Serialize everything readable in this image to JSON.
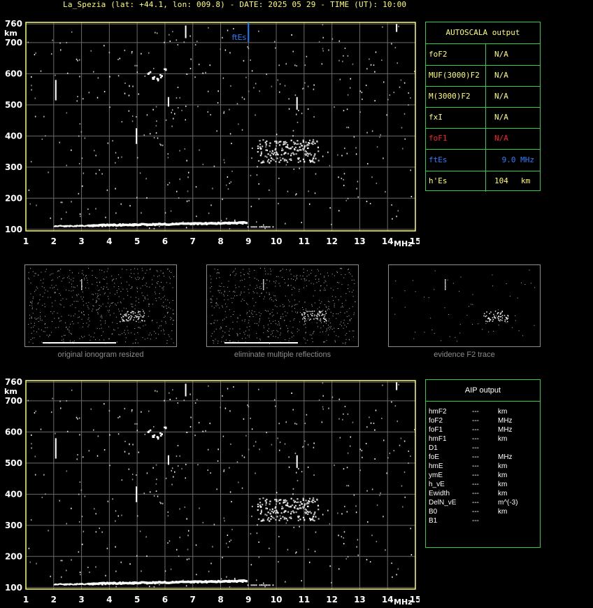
{
  "header": {
    "title": "La_Spezia (lat: +44.1, lon: 009.8) - DATE: 2025 05 29 - TIME (UT): 10:00"
  },
  "colors": {
    "axis": "#ffff66",
    "grid": "#6b6b6b",
    "table_border": "#2ecc40",
    "fte_blue": "#2a7fff",
    "fof1_red": "#ff2020",
    "text_yellow": "#ffff66"
  },
  "chart_data": [
    {
      "type": "scatter",
      "title": "",
      "xlabel": "MHz",
      "ylabel": "km",
      "xlim": [
        1,
        15
      ],
      "ylim": [
        95,
        765
      ],
      "x_ticks": [
        "1",
        "2",
        "3",
        "4",
        "5",
        "6",
        "7",
        "8",
        "9",
        "10",
        "11",
        "12",
        "13",
        "14",
        "15"
      ],
      "y_ticks": [
        "100",
        "200",
        "300",
        "400",
        "500",
        "600",
        "700",
        "760"
      ],
      "grid": true,
      "marker": {
        "label": "ftEs",
        "x": 9.0
      },
      "traces": [
        {
          "name": "",
          "points": [
            [
              2.0,
              107
            ],
            [
              2.5,
              110
            ],
            [
              3.0,
              112
            ],
            [
              3.5,
              114
            ],
            [
              4.0,
              115
            ],
            [
              5.0,
              115
            ],
            [
              6.0,
              116
            ],
            [
              7.0,
              117
            ],
            [
              8.0,
              118
            ],
            [
              8.8,
              118
            ]
          ]
        },
        {
          "name": "",
          "points": [
            [
              5.4,
              605
            ],
            [
              5.55,
              590
            ],
            [
              5.7,
              585
            ],
            [
              5.85,
              595
            ],
            [
              6.0,
              615
            ]
          ]
        },
        {
          "name": "",
          "points": [
            [
              9.5,
              360
            ],
            [
              10.0,
              355
            ],
            [
              10.5,
              350
            ],
            [
              11.0,
              345
            ],
            [
              11.4,
              340
            ]
          ]
        }
      ]
    },
    {
      "type": "scatter",
      "title": "",
      "xlabel": "MHz",
      "ylabel": "km",
      "xlim": [
        1,
        15
      ],
      "ylim": [
        95,
        765
      ],
      "x_ticks": [
        "1",
        "2",
        "3",
        "4",
        "5",
        "6",
        "7",
        "8",
        "9",
        "10",
        "11",
        "12",
        "13",
        "14",
        "15"
      ],
      "y_ticks": [
        "100",
        "200",
        "300",
        "400",
        "500",
        "600",
        "700",
        "760"
      ],
      "grid": true,
      "traces": [
        {
          "name": "",
          "points": [
            [
              2.0,
              107
            ],
            [
              2.5,
              110
            ],
            [
              3.0,
              112
            ],
            [
              3.5,
              114
            ],
            [
              4.0,
              115
            ],
            [
              5.0,
              115
            ],
            [
              6.0,
              116
            ],
            [
              7.0,
              117
            ],
            [
              8.0,
              118
            ],
            [
              8.8,
              118
            ]
          ]
        },
        {
          "name": "",
          "points": [
            [
              5.4,
              605
            ],
            [
              5.55,
              590
            ],
            [
              5.7,
              585
            ],
            [
              5.85,
              595
            ],
            [
              6.0,
              615
            ]
          ]
        },
        {
          "name": "",
          "points": [
            [
              9.5,
              360
            ],
            [
              10.0,
              355
            ],
            [
              10.5,
              350
            ],
            [
              11.0,
              345
            ],
            [
              11.4,
              340
            ]
          ]
        }
      ]
    }
  ],
  "autoscala": {
    "title": "AUTOSCALA output",
    "rows": [
      {
        "param": "foF2",
        "value": "N/A",
        "unit": "",
        "color": "#ffff66"
      },
      {
        "param": "MUF(3000)F2",
        "value": "N/A",
        "unit": "",
        "color": "#ffff66"
      },
      {
        "param": "M(3000)F2",
        "value": "N/A",
        "unit": "",
        "color": "#ffff66"
      },
      {
        "param": "fxI",
        "value": "N/A",
        "unit": "",
        "color": "#ffff66"
      },
      {
        "param": "foF1",
        "value": "N/A",
        "unit": "",
        "color": "#ff2020"
      },
      {
        "param": "ftEs",
        "value": "9.0 MHz",
        "unit": "",
        "color": "#2a7fff"
      },
      {
        "param": "h'Es",
        "value": "104",
        "unit": "km",
        "color": "#ffff66"
      }
    ]
  },
  "thumbnails": [
    {
      "caption": "original ionogram resized"
    },
    {
      "caption": "eliminate multiple reflections"
    },
    {
      "caption": "evidence F2 trace"
    }
  ],
  "aip": {
    "title": "AIP output",
    "rows": [
      {
        "param": "hmF2",
        "value": "---",
        "unit": "km"
      },
      {
        "param": "foF2",
        "value": "---",
        "unit": "MHz"
      },
      {
        "param": "foF1",
        "value": "---",
        "unit": "MHz"
      },
      {
        "param": "hmF1",
        "value": "---",
        "unit": "km"
      },
      {
        "param": "D1",
        "value": "---",
        "unit": ""
      },
      {
        "param": "foE",
        "value": "---",
        "unit": "MHz"
      },
      {
        "param": "hmE",
        "value": "---",
        "unit": "km"
      },
      {
        "param": "ymE",
        "value": "---",
        "unit": "km"
      },
      {
        "param": "h_vE",
        "value": "---",
        "unit": "km"
      },
      {
        "param": "Ewidth",
        "value": "---",
        "unit": "km"
      },
      {
        "param": "DelN_vE",
        "value": "---",
        "unit": "m^(-3)"
      },
      {
        "param": "B0",
        "value": "---",
        "unit": "km"
      },
      {
        "param": "B1",
        "value": "---",
        "unit": ""
      }
    ]
  }
}
